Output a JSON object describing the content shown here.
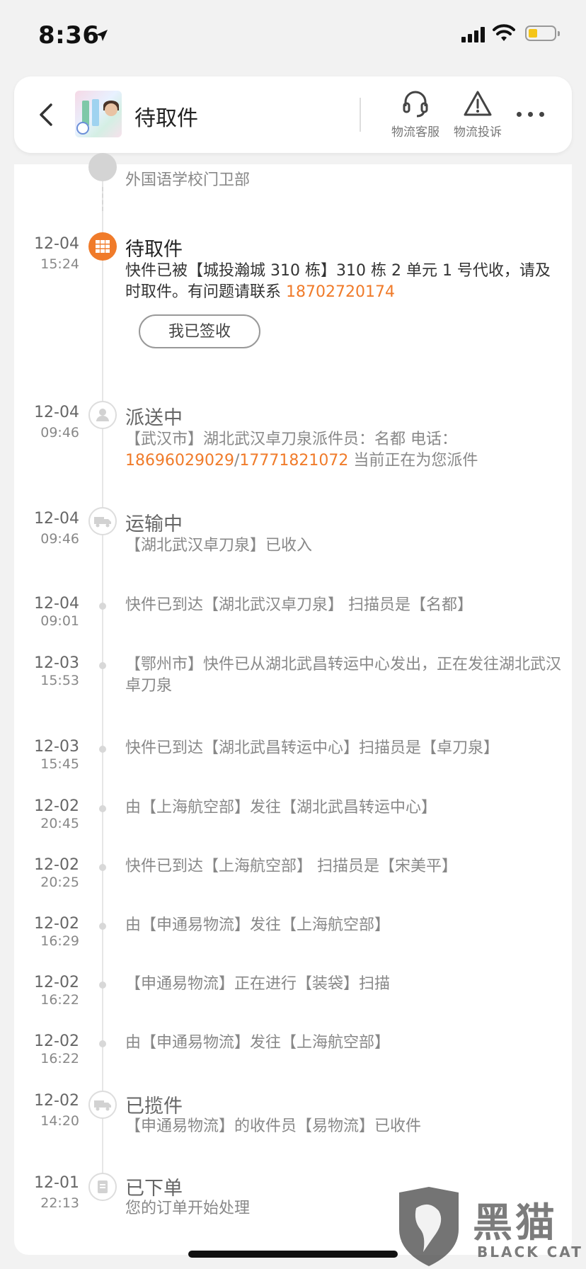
{
  "status_bar": {
    "time": "8:36"
  },
  "header": {
    "title": "待取件",
    "service_label": "物流客服",
    "complaint_label": "物流投诉"
  },
  "timeline": {
    "top_partial": {
      "desc": "外国语学校门卫部"
    },
    "events": [
      {
        "date": "12-04",
        "time": "15:24",
        "status": "待取件",
        "desc_prefix": "快件已被【城投瀚城 310 栋】310 栋 2 单元 1 号代收，请及时取件。有问题请联系 ",
        "phone": "18702720174",
        "button": "我已签收"
      },
      {
        "date": "12-04",
        "time": "09:46",
        "status": "派送中",
        "desc_prefix": "【武汉市】湖北武汉卓刀泉派件员：名都 电话：",
        "phone1": "18696029029",
        "sep": "/",
        "phone2": "17771821072",
        "desc_suffix": " 当前正在为您派件"
      },
      {
        "date": "12-04",
        "time": "09:46",
        "status": "运输中",
        "desc": "【湖北武汉卓刀泉】已收入"
      },
      {
        "date": "12-04",
        "time": "09:01",
        "desc": "快件已到达【湖北武汉卓刀泉】 扫描员是【名都】"
      },
      {
        "date": "12-03",
        "time": "15:53",
        "desc": "【鄂州市】快件已从湖北武昌转运中心发出，正在发往湖北武汉卓刀泉"
      },
      {
        "date": "12-03",
        "time": "15:45",
        "desc": "快件已到达【湖北武昌转运中心】扫描员是【卓刀泉】"
      },
      {
        "date": "12-02",
        "time": "20:45",
        "desc": "由【上海航空部】发往【湖北武昌转运中心】"
      },
      {
        "date": "12-02",
        "time": "20:25",
        "desc": "快件已到达【上海航空部】 扫描员是【宋美平】"
      },
      {
        "date": "12-02",
        "time": "16:29",
        "desc": "由【申通易物流】发往【上海航空部】"
      },
      {
        "date": "12-02",
        "time": "16:22",
        "desc": "【申通易物流】正在进行【装袋】扫描"
      },
      {
        "date": "12-02",
        "time": "16:22",
        "desc": "由【申通易物流】发往【上海航空部】"
      },
      {
        "date": "12-02",
        "time": "14:20",
        "status": "已揽件",
        "desc": "【申通易物流】的收件员【易物流】已收件"
      },
      {
        "date": "12-01",
        "time": "22:13",
        "status": "已下单",
        "desc": "您的订单开始处理"
      }
    ]
  },
  "watermark": {
    "big": "黑猫",
    "small": "BLACK CAT"
  },
  "colors": {
    "accent": "#f07b2a",
    "battery": "#f5c518"
  }
}
